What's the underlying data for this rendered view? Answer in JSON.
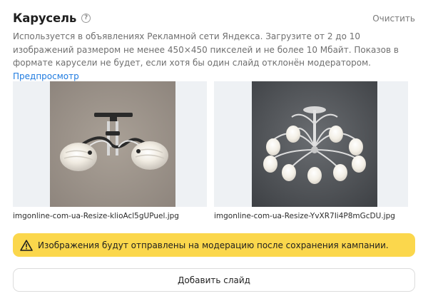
{
  "header": {
    "title": "Карусель",
    "help_icon": "question-circle-icon",
    "help_glyph": "?",
    "clear_label": "Очистить"
  },
  "description": {
    "text": "Используется в объявлениях Рекламной сети Яндекса. Загрузите от 2 до 10 изображений размером не менее 450×450 пикселей и не более 10 Мбайт. Показов в формате карусели не будет, если хотя бы один слайд отклонён модератором.",
    "link_label": "Предпросмотр"
  },
  "slides": [
    {
      "image": "chandelier-photo-3-arm",
      "file_name": "imgonline-com-ua-Resize-klioAcl5gUPuel.jpg"
    },
    {
      "image": "chandelier-photo-8-arm",
      "file_name": "imgonline-com-ua-Resize-YvXR7Ii4P8mGcDU.jpg"
    }
  ],
  "warning": {
    "icon": "warning-triangle-icon",
    "text": "Изображения будут отправлены на модерацию после сохранения кампании."
  },
  "add_slide_label": "Добавить слайд",
  "colors": {
    "accent_link": "#1f7be0",
    "warning_bg": "#fbd74c",
    "muted_text": "#6f6f6f"
  }
}
